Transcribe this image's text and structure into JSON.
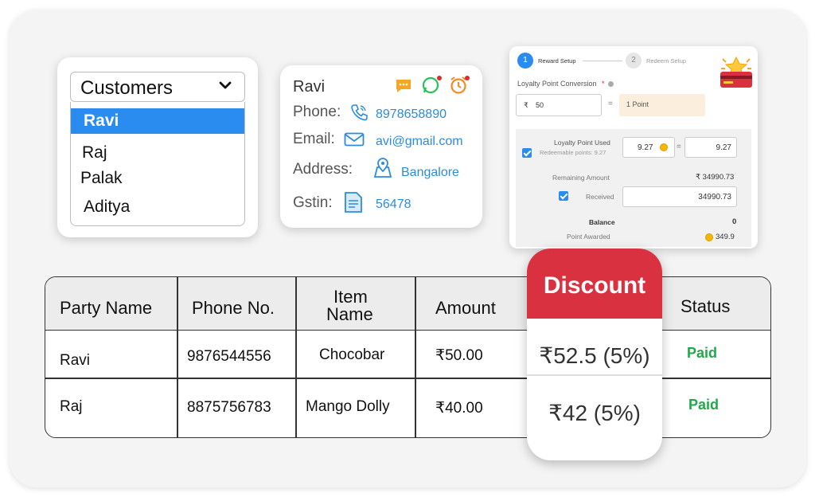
{
  "customers": {
    "label": "Customers",
    "items": [
      "Ravi",
      "Raj",
      "Palak",
      "Aditya"
    ]
  },
  "contact": {
    "name": "Ravi",
    "phone_label": "Phone:",
    "phone": "8978658890",
    "email_label": "Email:",
    "email": "avi@gmail.com",
    "address_label": "Address:",
    "address": "Bangalore",
    "gstin_label": "Gstin:",
    "gstin": "56478"
  },
  "loyalty": {
    "step1_num": "1",
    "step1_label": "Reward Setup",
    "step2_num": "2",
    "step2_label": "Redeem Setup",
    "conversion_label": "Loyalty Point Conversion",
    "required_mark": "*",
    "rupee_symbol": "₹",
    "conversion_value": "50",
    "equals": "=",
    "point_value": "1 Point",
    "used_label": "Loyalty Point Used",
    "redeemable_label": "Redeemable points: 9.27",
    "used_value": "9.27",
    "used_result": "9.27",
    "remaining_label": "Remaining Amount",
    "remaining_value": "₹ 34990.73",
    "received_label": "Received",
    "received_value": "34990.73",
    "balance_label": "Balance",
    "balance_value": "0",
    "awarded_label": "Point Awarded",
    "awarded_value": "349.9"
  },
  "table": {
    "headers": [
      "Party Name",
      "Phone No.",
      "Item",
      "Name",
      "Amount",
      "Status"
    ],
    "rows": [
      {
        "party": "Ravi",
        "phone": "9876544556",
        "item": "Chocobar",
        "amount": "₹50.00",
        "status": "Paid"
      },
      {
        "party": "Raj",
        "phone": "8875756783",
        "item": "Mango Dolly",
        "amount": "₹40.00",
        "status": "Paid"
      }
    ]
  },
  "discount": {
    "header": "Discount",
    "values": [
      "₹52.5 (5%)",
      "₹42 (5%)"
    ]
  },
  "colors": {
    "accent_blue": "#2b8cf0",
    "discount_red": "#d9313f",
    "paid_green": "#22a84a",
    "link_blue": "#2a8ce0"
  }
}
